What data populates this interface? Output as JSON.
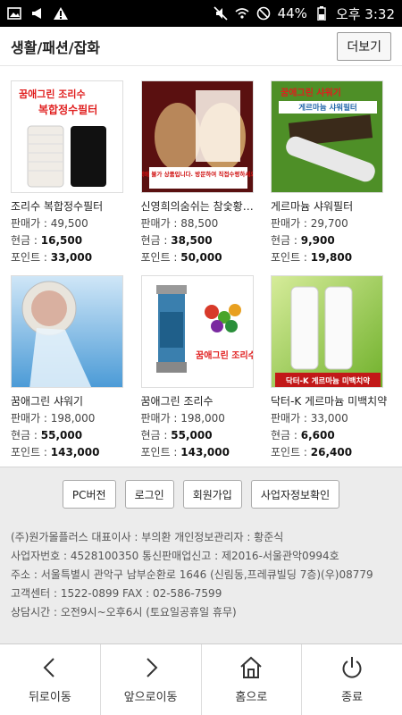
{
  "statusbar": {
    "icons_left": [
      "image-icon",
      "megaphone-icon",
      "warning-icon"
    ],
    "battery": "44%",
    "time": "오후 3:32"
  },
  "header": {
    "title": "생활/패션/잡화",
    "more_label": "더보기"
  },
  "products": [
    {
      "name": "조리수 복합정수필터",
      "list_price": "판매가 : 49,500",
      "cash_price": "16,500",
      "points": "33,000",
      "cash_label": "현금 : ",
      "points_label": "포인트 : ",
      "thumb_text": "복합정수필터",
      "thumb_brand": "꿈애그린 조리수"
    },
    {
      "name": "신영희의숨쉬는 참숯황…",
      "list_price": "판매가 : 88,500",
      "cash_price": "38,500",
      "points": "50,000",
      "cash_label": "현금 : ",
      "points_label": "포인트 : ",
      "thumb_text": "택배 불가 상품입니다. 방문하여 직접수령하세요.",
      "thumb_brand": ""
    },
    {
      "name": "게르마늄 샤워필터",
      "list_price": "판매가 : 29,700",
      "cash_price": "9,900",
      "points": "19,800",
      "cash_label": "현금 : ",
      "points_label": "포인트 : ",
      "thumb_text": "게르마늄 샤워필터",
      "thumb_brand": "꿈애그린 샤워기"
    },
    {
      "name": "꿈애그린 샤워기",
      "list_price": "판매가 : 198,000",
      "cash_price": "55,000",
      "points": "143,000",
      "cash_label": "현금 : ",
      "points_label": "포인트 : ",
      "thumb_text": "",
      "thumb_brand": ""
    },
    {
      "name": "꿈애그린 조리수",
      "list_price": "판매가 : 198,000",
      "cash_price": "55,000",
      "points": "143,000",
      "cash_label": "현금 : ",
      "points_label": "포인트 : ",
      "thumb_text": "",
      "thumb_brand": "꿈애그린 조리수"
    },
    {
      "name": "닥터-K 게르마늄 미백치약",
      "list_price": "판매가 : 33,000",
      "cash_price": "6,600",
      "points": "26,400",
      "cash_label": "현금 : ",
      "points_label": "포인트 : ",
      "thumb_text": "닥터-K 게르마늄 미백치약",
      "thumb_brand": ""
    }
  ],
  "footer": {
    "buttons": [
      "PC버전",
      "로그인",
      "회원가입",
      "사업자정보확인"
    ],
    "info_lines": [
      "(주)원가몰플러스    대표이사 : 부의환    개인정보관리자 : 황준식",
      "사업자번호 : 4528100350    통신판매업신고 : 제2016-서울관악0994호",
      "주소 : 서울특별시 관악구 남부순환로 1646 (신림동,프레큐빌딩 7층)(우)08779",
      "고객센터 : 1522-0899    FAX : 02-586-7599",
      "상담시간 : 오전9시~오후6시 (토요일공휴일 휴무)"
    ]
  },
  "bottomnav": {
    "items": [
      {
        "label": "뒤로이동",
        "icon": "back-chevron-icon"
      },
      {
        "label": "앞으로이동",
        "icon": "forward-chevron-icon"
      },
      {
        "label": "홈으로",
        "icon": "home-icon"
      },
      {
        "label": "종료",
        "icon": "power-icon"
      }
    ]
  },
  "colors": {
    "statusbar_bg": "#000000",
    "footer_bg": "#ececec",
    "thumb_red": "#e01e1e",
    "thumb_green": "#5a9a2a"
  }
}
